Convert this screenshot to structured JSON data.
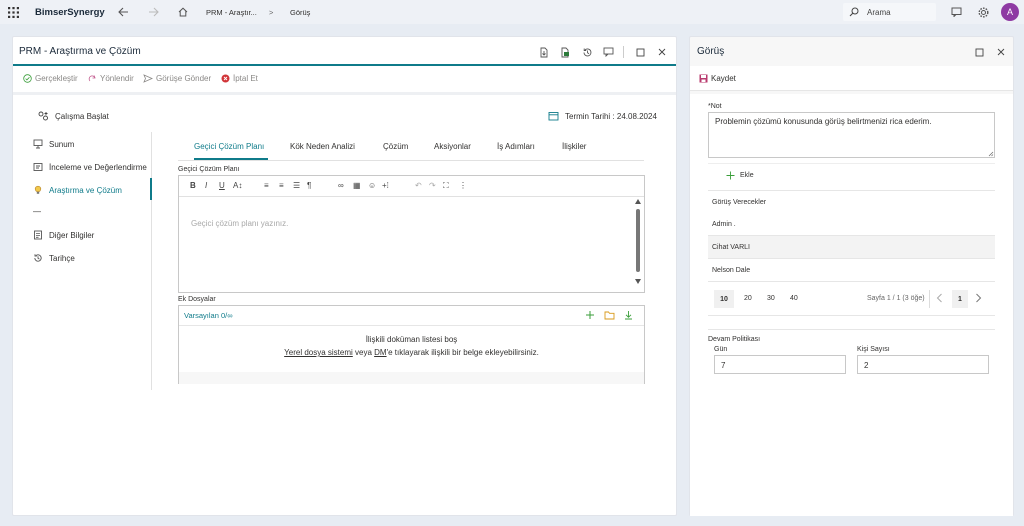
{
  "topbar": {
    "app_name": "BimserSynergy",
    "breadcrumb_1": "PRM - Araştır...",
    "breadcrumb_sep": ">",
    "breadcrumb_2": "Görüş",
    "search_placeholder": "Arama",
    "avatar_letter": "A"
  },
  "left": {
    "title": "PRM - Araştırma ve Çözüm",
    "toolbar": {
      "complete": "Gerçekleştir",
      "redirect": "Yönlendir",
      "send_opinion": "Görüşe Gönder",
      "cancel": "İptal Et"
    },
    "start_work": "Çalışma Başlat",
    "due_date": "Termin Tarihi : 24.08.2024",
    "nav": [
      "Sunum",
      "İnceleme ve Değerlendirme",
      "Araştırma ve Çözüm",
      "—",
      "Diğer Bilgiler",
      "Tarihçe"
    ],
    "tabs": [
      "Geçici Çözüm Planı",
      "Kök Neden Analizi",
      "Çözüm",
      "Aksiyonlar",
      "İş Adımları",
      "İlişkiler"
    ],
    "editor_label": "Geçici Çözüm Planı",
    "editor_placeholder": "Geçici çözüm planı yazınız.",
    "attachments_label": "Ek Dosyalar",
    "attachments_default": "Varsayılan 0/∞",
    "attachments_empty": "İlişkili doküman listesi boş",
    "attachments_hint_link1": "Yerel dosya sistemi",
    "attachments_hint_mid": " veya ",
    "attachments_hint_link2": "DM",
    "attachments_hint_tail": "'e tıklayarak ilişkili bir belge ekleyebilirsiniz."
  },
  "right": {
    "title": "Görüş",
    "save": "Kaydet",
    "note_label": "*Not",
    "note_value": "Problemin çözümü konusunda görüş belirtmenizi rica ederim.",
    "add": "Ekle",
    "list_header": "Görüş Verecekler",
    "people": [
      "Admin .",
      "Cihat VARLI",
      "Nelson Dale"
    ],
    "page_sizes": [
      "10",
      "20",
      "30",
      "40"
    ],
    "page_info": "Sayfa 1 / 1 (3 öğe)",
    "current_page": "1",
    "policy_label": "Devam Politikası",
    "day_label": "Gün",
    "day_value": "7",
    "people_count_label": "Kişi Sayısı",
    "people_count_value": "2"
  },
  "colors": {
    "accent": "#0f7b8a",
    "avatar": "#8e3aa3",
    "green_plus": "#3a9e3a",
    "folder": "#d99a1a",
    "cancel_red": "#d13438"
  }
}
